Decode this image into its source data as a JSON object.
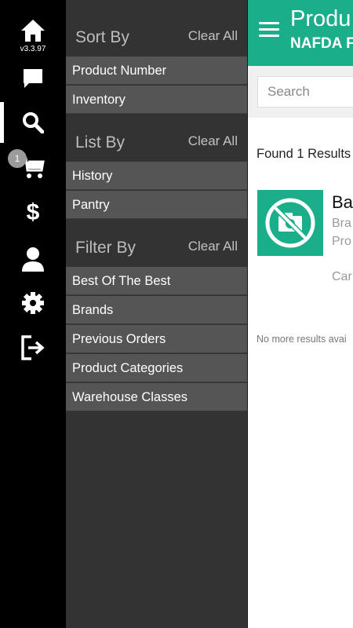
{
  "rail": {
    "version": "v3.3.97",
    "cart_count": "1",
    "icons": [
      "home-icon",
      "chat-icon",
      "search-icon",
      "cart-icon",
      "dollar-icon",
      "user-icon",
      "gear-icon",
      "logout-icon"
    ]
  },
  "filters": {
    "sort": {
      "title": "Sort By",
      "clear": "Clear All",
      "options": [
        "Product Number",
        "Inventory"
      ]
    },
    "list": {
      "title": "List By",
      "clear": "Clear All",
      "options": [
        "History",
        "Pantry"
      ]
    },
    "filter": {
      "title": "Filter By",
      "clear": "Clear All",
      "options": [
        "Best Of The Best",
        "Brands",
        "Previous Orders",
        "Product Categories",
        "Warehouse Classes"
      ]
    }
  },
  "header": {
    "title": "Produ",
    "subtitle": "NAFDA F"
  },
  "search": {
    "placeholder": "Search"
  },
  "results": {
    "found": "Found 1 Results",
    "product": {
      "name": "Bal",
      "brand": "Bra",
      "number": "Pro",
      "case": "Car"
    },
    "end_text": "No more results avai"
  },
  "colors": {
    "accent": "#1aae8b",
    "panel": "#333333",
    "option_bg": "#555555",
    "rail": "#000000"
  }
}
